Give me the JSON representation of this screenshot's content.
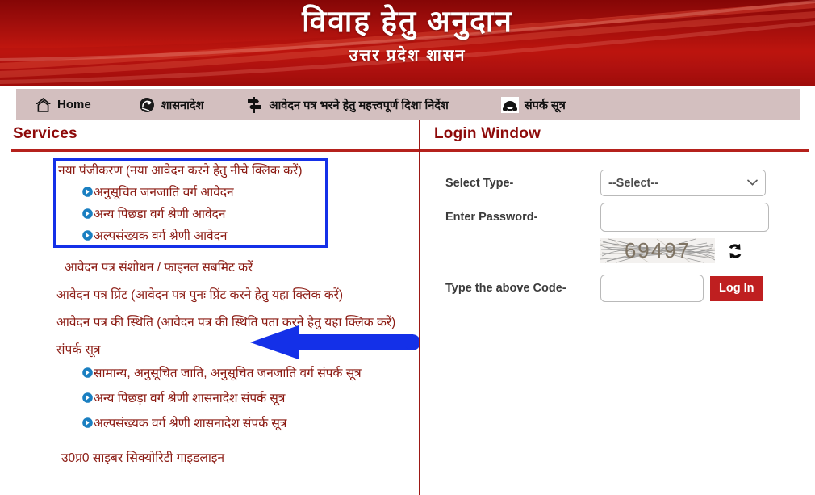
{
  "banner": {
    "title": "विवाह हेतु अनुदान",
    "subtitle": "उत्तर प्रदेश शासन",
    "bg_color": "#a50f0c"
  },
  "nav": {
    "items": [
      {
        "id": "home",
        "label": "Home",
        "icon": "home-icon"
      },
      {
        "id": "order",
        "label": "शासनादेश",
        "icon": "government-order-icon"
      },
      {
        "id": "guide",
        "label": "आवेदन पत्र भरने हेतु महत्त्वपूर्ण दिशा निर्देश",
        "icon": "signpost-icon"
      },
      {
        "id": "contact",
        "label": "संपर्क सूत्र",
        "icon": "telephone-icon"
      }
    ],
    "bg_color": "#d3bfbf"
  },
  "services": {
    "heading": "Services",
    "accent_color": "#8d0a0a",
    "highlight_box_color": "#1430e8",
    "registration_group": {
      "heading": "नया पंजीकरण (नया आवेदन करने हेतु नीचे क्लिक करें)",
      "links": [
        "अनुसूचित जनजाति वर्ग आवेदन",
        "अन्य पिछड़ा वर्ग श्रेणी आवेदन",
        "अल्पसंख्यक वर्ग श्रेणी आवेदन"
      ]
    },
    "plain_links": [
      "आवेदन पत्र संशोधन / फाइनल सबमिट करें",
      "आवेदन पत्र प्रिंट (आवेदन पत्र पुनः प्रिंट करने हेतु यहा क्लिक करें)",
      "आवेदन पत्र की स्थिति (आवेदन पत्र की स्थिति पता करने हेतु यहा क्लिक करें)"
    ],
    "contact_group": {
      "heading": "संपर्क सूत्र",
      "links": [
        "सामान्य, अनुसूचित जाति, अनुसूचित जनजाति वर्ग संपर्क सूत्र",
        "अन्य पिछड़ा वर्ग श्रेणी शासनादेश संपर्क सूत्र",
        "अल्पसंख्यक वर्ग श्रेणी शासनादेश संपर्क सूत्र"
      ]
    },
    "cyber_guideline": "उ0प्र0 साइबर सिक्योरिटी गाइडलाइन"
  },
  "login": {
    "heading": "Login Window",
    "select_type_label": "Select Type-",
    "select_type_value": "--Select--",
    "password_label": "Enter Password-",
    "password_value": "",
    "password_placeholder": "",
    "captcha_code": "69497",
    "refresh_icon": "refresh-icon",
    "code_label": "Type the above Code-",
    "code_value": "",
    "code_placeholder": "",
    "login_button": "Log In",
    "login_button_color": "#bf1f20"
  }
}
